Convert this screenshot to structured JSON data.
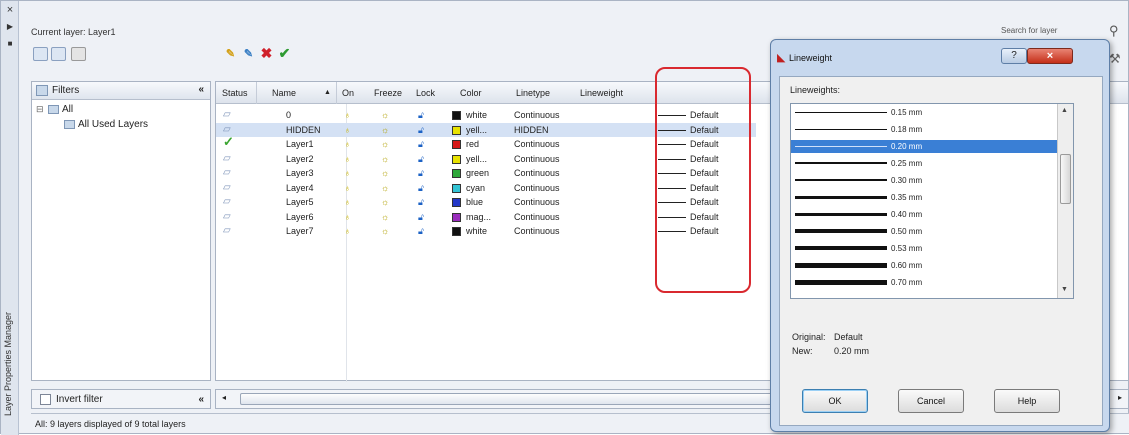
{
  "palette": {
    "title": "Layer Properties Manager",
    "current_layer": "Current layer: Layer1",
    "search_placeholder": "Search for layer"
  },
  "filters": {
    "header": "Filters",
    "collapse": "«",
    "root": "All",
    "child": "All Used Layers",
    "invert_label": "Invert filter"
  },
  "columns": {
    "status": "Status",
    "name": "Name",
    "sort": "▲",
    "on": "On",
    "freeze": "Freeze",
    "lock": "Lock",
    "color": "Color",
    "linetype": "Linetype",
    "lineweight": "Lineweight"
  },
  "layers": [
    {
      "name": "0",
      "color_name": "white",
      "color": "#111111",
      "linetype": "Continuous",
      "lineweight": "Default"
    },
    {
      "name": "HIDDEN",
      "color_name": "yell...",
      "color": "#e8e200",
      "linetype": "HIDDEN",
      "lineweight": "Default"
    },
    {
      "name": "Layer1",
      "color_name": "red",
      "color": "#d71a1a",
      "linetype": "Continuous",
      "lineweight": "Default"
    },
    {
      "name": "Layer2",
      "color_name": "yell...",
      "color": "#e8e200",
      "linetype": "Continuous",
      "lineweight": "Default"
    },
    {
      "name": "Layer3",
      "color_name": "green",
      "color": "#2ea83a",
      "linetype": "Continuous",
      "lineweight": "Default"
    },
    {
      "name": "Layer4",
      "color_name": "cyan",
      "color": "#33c4d4",
      "linetype": "Continuous",
      "lineweight": "Default"
    },
    {
      "name": "Layer5",
      "color_name": "blue",
      "color": "#2438c8",
      "linetype": "Continuous",
      "lineweight": "Default"
    },
    {
      "name": "Layer6",
      "color_name": "mag...",
      "color": "#9a2dbd",
      "linetype": "Continuous",
      "lineweight": "Default"
    },
    {
      "name": "Layer7",
      "color_name": "white",
      "color": "#111111",
      "linetype": "Continuous",
      "lineweight": "Default"
    }
  ],
  "status_bar": "All: 9 layers displayed of 9 total layers",
  "dialog": {
    "title": "Lineweight",
    "list_label": "Lineweights:",
    "options": [
      "0.15 mm",
      "0.18 mm",
      "0.20 mm",
      "0.25 mm",
      "0.30 mm",
      "0.35 mm",
      "0.40 mm",
      "0.50 mm",
      "0.53 mm",
      "0.60 mm",
      "0.70 mm"
    ],
    "selected": "0.20 mm",
    "original_label": "Original:",
    "original_value": "Default",
    "new_label": "New:",
    "new_value": "0.20 mm",
    "ok": "OK",
    "cancel": "Cancel",
    "help": "Help"
  },
  "icons": {
    "close": "×",
    "pin": "▶",
    "menu": "■",
    "current": "✓",
    "check": "✔",
    "delete": "✖"
  }
}
